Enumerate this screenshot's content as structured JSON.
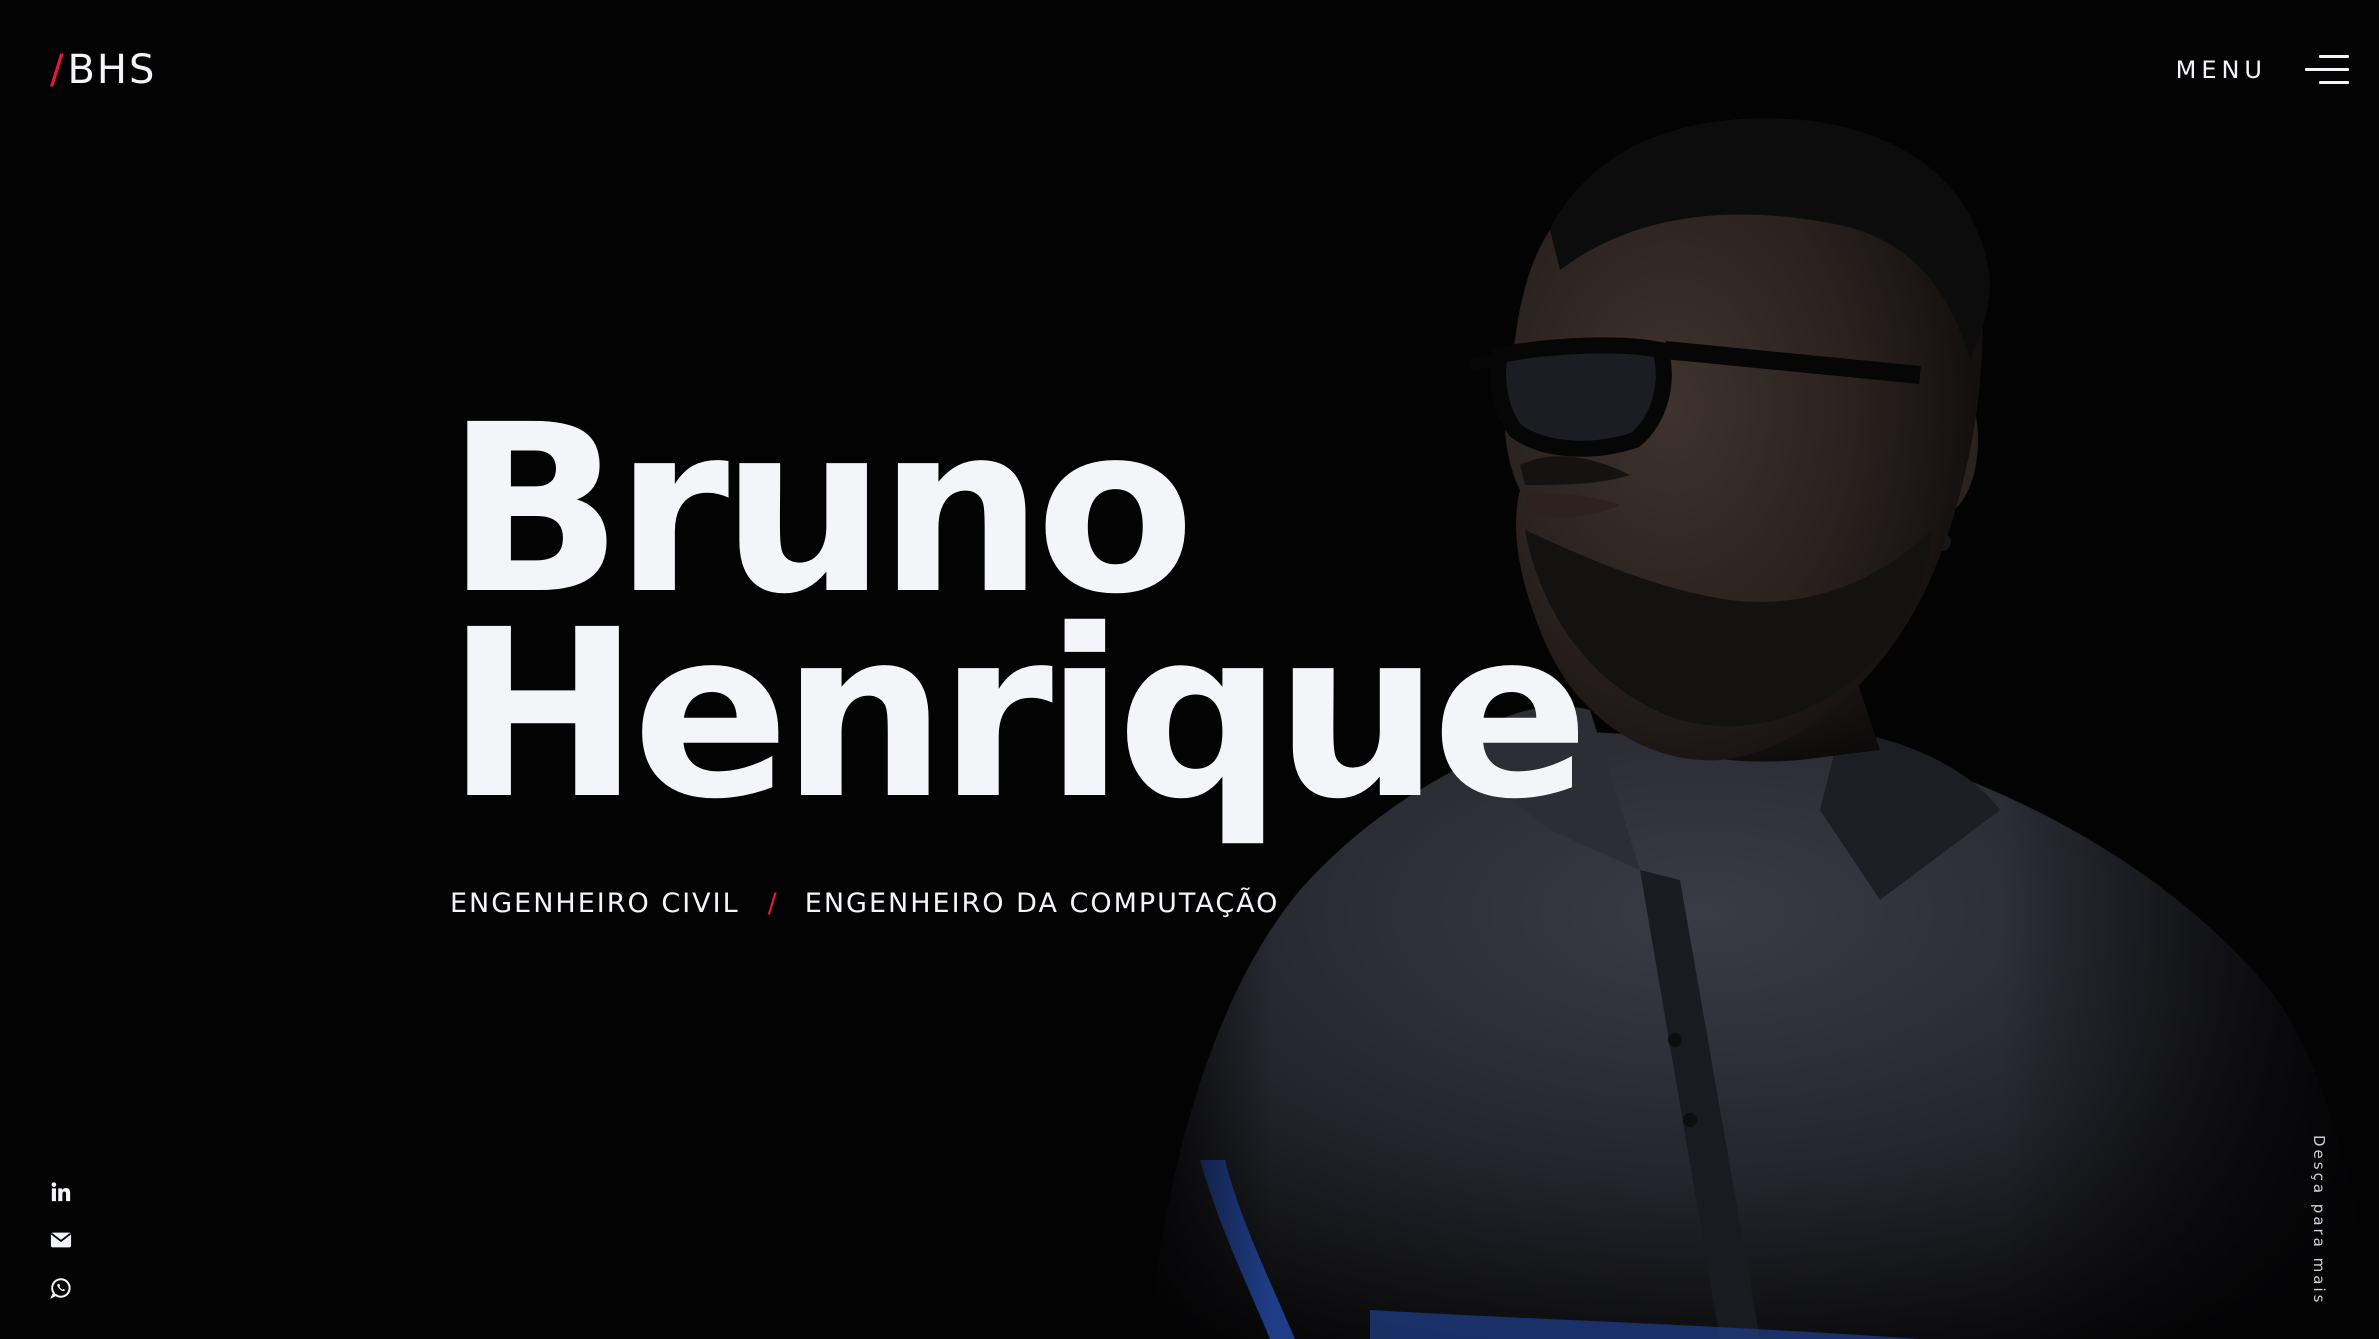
{
  "header": {
    "logo_slash": "/",
    "logo_text": "BHS",
    "menu_label": "MENU"
  },
  "hero": {
    "first_name": "Bruno",
    "last_name": "Henrique",
    "role_1": "ENGENHEIRO CIVIL",
    "role_separator": "/",
    "role_2": "ENGENHEIRO DA COMPUTAÇÃO"
  },
  "social": [
    {
      "icon": "linkedin-icon"
    },
    {
      "icon": "envelope-icon"
    },
    {
      "icon": "whatsapp-icon"
    }
  ],
  "scroll_hint": "Desça para mais",
  "colors": {
    "background": "#030304",
    "text": "#f4f5f8",
    "accent": "#e8173c"
  }
}
